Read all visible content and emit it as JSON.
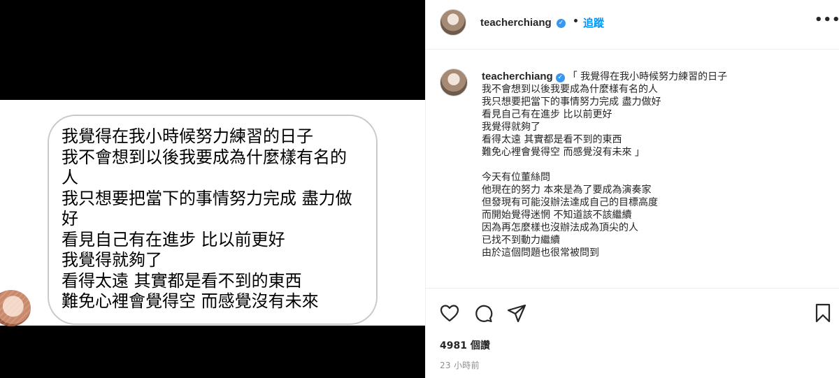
{
  "media": {
    "bubble_lines": [
      "我覺得在我小時候努力練習的日子",
      "我不會想到以後我要成為什麼樣有名的",
      "人",
      "我只想要把當下的事情努力完成 盡力做",
      "好",
      "看見自己有在進步 比以前更好",
      "我覺得就夠了",
      "看得太遠 其實都是看不到的東西",
      "難免心裡會覺得空 而感覺沒有未來"
    ]
  },
  "header": {
    "username": "teacherchiang",
    "verified_icon": "✓",
    "separator": "•",
    "follow_label": "追蹤",
    "more_icon": "•••"
  },
  "caption": {
    "username": "teacherchiang",
    "lines": [
      "「 我覺得在我小時候努力練習的日子",
      "我不會想到以後我要成為什麼樣有名的人",
      "我只想要把當下的事情努力完成 盡力做好",
      "看見自己有在進步 比以前更好",
      "我覺得就夠了",
      "看得太遠 其實都是看不到的東西",
      "難免心裡會覺得空 而感覺沒有未來 」",
      "",
      "今天有位董絲問",
      "他現在的努力 本來是為了要成為演奏家",
      "但發現有可能沒辦法達成自己的目標高度",
      "而開始覺得迷惘 不知道該不該繼續",
      "因為再怎麼樣也沒辦法成為頂尖的人",
      "已找不到動力繼續",
      "由於這個問題也很常被問到"
    ]
  },
  "actions": {
    "views": "4981 個讚",
    "timestamp": "23 小時前"
  }
}
